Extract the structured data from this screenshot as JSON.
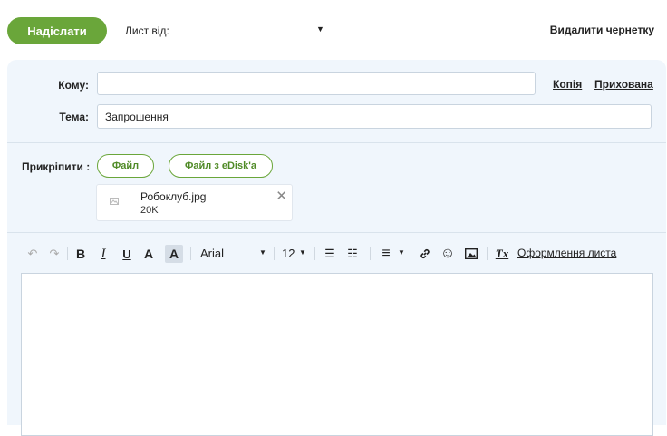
{
  "top_bar": {
    "send_label": "Надіслати",
    "from_label": "Лист від:",
    "from_dropdown_arrow": "▼",
    "delete_draft_label": "Видалити чернетку"
  },
  "header": {
    "to_label": "Кому:",
    "to_value": "",
    "cc_link": "Копія",
    "bcc_link": "Прихована",
    "subject_label": "Тема:",
    "subject_value": "Запрошення"
  },
  "attachments": {
    "label": "Прикріпити :",
    "file_button": "Файл",
    "edisk_button": "Файл з eDisk'a",
    "items": [
      {
        "name": "Робоклуб.jpg",
        "size": "20K",
        "thumb_icon": "image-thumb-icon",
        "remove_glyph": "✕"
      }
    ]
  },
  "toolbar": {
    "undo_glyph": "↶",
    "redo_glyph": "↷",
    "bold_label": "B",
    "italic_label": "I",
    "underline_label": "U",
    "font_color_label": "A",
    "bg_color_label": "A",
    "font_name": "Arial",
    "font_size": "12",
    "dropdown_arrow": "▼",
    "ordered_list_glyph": "☰",
    "unordered_list_glyph": "☷",
    "align_glyph": "≡",
    "link_glyph": "🔗",
    "emoji_glyph": "☺",
    "image_glyph": "▣",
    "clear_format_label": "Tx",
    "design_link": "Оформлення листа"
  },
  "editor": {
    "body_text": ""
  },
  "colors": {
    "accent": "#6aa63a",
    "panel_bg": "#f0f6fc"
  }
}
